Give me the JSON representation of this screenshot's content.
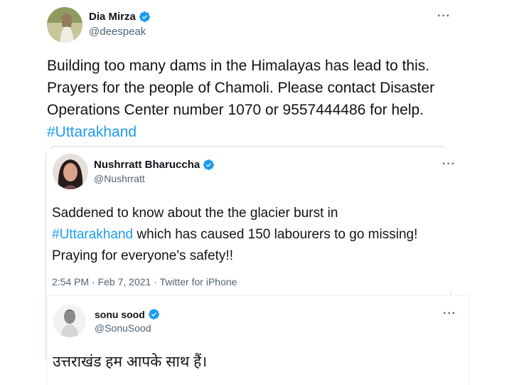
{
  "tweet1": {
    "name": "Dia Mirza",
    "handle": "@deespeak",
    "text_before": "Building too many dams in the Himalayas has lead to this. Prayers for the people of Chamoli. Please contact Disaster Operations Center number 1070 or 9557444486 for help. ",
    "hashtag": "#Uttarakhand"
  },
  "tweet2": {
    "name": "Nushrratt Bharuccha",
    "handle": "@Nushrratt",
    "text_before": "Saddened to know about the the glacier burst in",
    "hashtag": "#Uttarakhand",
    "text_after": " which has caused 150 labourers to go missing! Praying for everyone's safety!!",
    "timestamp": "2:54 PM · Feb 7, 2021 · Twitter for iPhone"
  },
  "tweet3": {
    "name": "sonu sood",
    "handle": "@SonuSood",
    "text": "उत्तराखंड हम आपके साथ हैं।"
  },
  "colors": {
    "link": "#1d9bf0",
    "secondary": "#536471",
    "border": "#cfd9de"
  },
  "icons": [
    "verified-badge-icon",
    "more-options-icon"
  ]
}
